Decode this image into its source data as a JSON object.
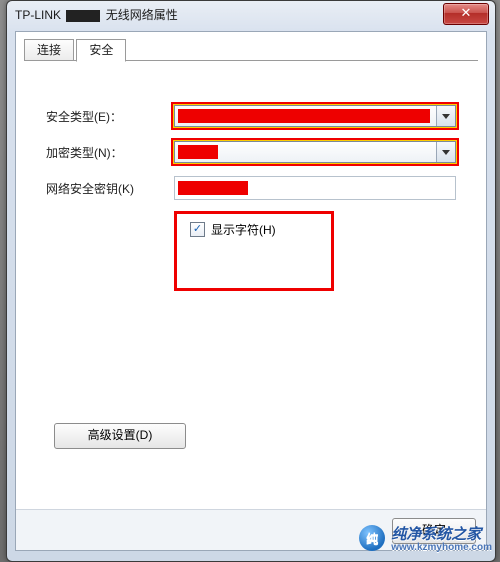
{
  "window": {
    "title_prefix": "TP-LINK",
    "title_suffix": "无线网络属性",
    "close_glyph": "✕"
  },
  "tabs": {
    "connection": "连接",
    "security": "安全"
  },
  "labels": {
    "security_type": "安全类型(E)：",
    "encryption_type": "加密类型(N)：",
    "network_key": "网络安全密钥(K)"
  },
  "checkbox": {
    "show_chars": "显示字符(H)",
    "checked_glyph": "✓"
  },
  "buttons": {
    "advanced": "高级设置(D)",
    "ok": "确定"
  },
  "watermark": {
    "badge": "纯",
    "name": "纯净系统之家",
    "url": "www.kzmyhome.com"
  }
}
